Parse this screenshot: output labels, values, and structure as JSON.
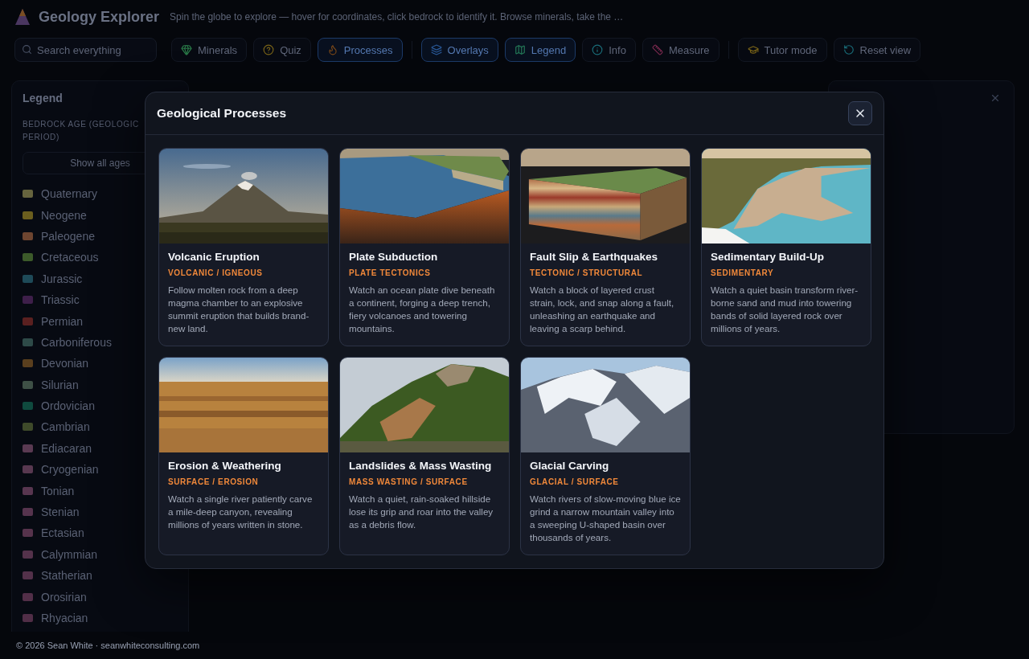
{
  "app": {
    "title": "Geology Explorer",
    "subtitle": "Spin the globe to explore — hover for coordinates, click bedrock to identify it. Browse minerals, take the …"
  },
  "toolbar": {
    "search": {
      "placeholder": "Search everything"
    },
    "groups": [
      [
        {
          "kind": "minerals",
          "label": "Minerals",
          "active": false
        },
        {
          "kind": "quiz",
          "label": "Quiz",
          "active": false
        },
        {
          "kind": "processes",
          "label": "Processes",
          "active": true
        }
      ],
      [
        {
          "kind": "overlays",
          "label": "Overlays",
          "active": true
        },
        {
          "kind": "legend",
          "label": "Legend",
          "active": true
        },
        {
          "kind": "info",
          "label": "Info",
          "active": false
        },
        {
          "kind": "measure",
          "label": "Measure",
          "active": false
        }
      ],
      [
        {
          "kind": "tutor",
          "label": "Tutor mode",
          "active": false
        },
        {
          "kind": "reset",
          "label": "Reset view",
          "active": false
        }
      ]
    ]
  },
  "legend_panel": {
    "title": "Legend",
    "subtitle": "BEDROCK AGE (GEOLOGIC PERIOD)",
    "button": "Show all ages",
    "periods": [
      {
        "name": "Quaternary",
        "color": "#66643e"
      },
      {
        "name": "Neogene",
        "color": "#6b5e1e"
      },
      {
        "name": "Paleogene",
        "color": "#6e4530"
      },
      {
        "name": "Cretaceous",
        "color": "#3c5a2a"
      },
      {
        "name": "Jurassic",
        "color": "#1e4a58"
      },
      {
        "name": "Triassic",
        "color": "#3e1f4a"
      },
      {
        "name": "Permian",
        "color": "#5a2020"
      },
      {
        "name": "Carboniferous",
        "color": "#2e4a48"
      },
      {
        "name": "Devonian",
        "color": "#5a3f1e"
      },
      {
        "name": "Silurian",
        "color": "#3e5046"
      },
      {
        "name": "Ordovician",
        "color": "#0f4a3e"
      },
      {
        "name": "Cambrian",
        "color": "#3e4a2a"
      },
      {
        "name": "Ediacaran",
        "color": "#5a3a52"
      },
      {
        "name": "Cryogenian",
        "color": "#583850"
      },
      {
        "name": "Tonian",
        "color": "#583650"
      },
      {
        "name": "Stenian",
        "color": "#56344e"
      },
      {
        "name": "Ectasian",
        "color": "#56334c"
      },
      {
        "name": "Calymmian",
        "color": "#54324b"
      },
      {
        "name": "Statherian",
        "color": "#53314a"
      },
      {
        "name": "Orosirian",
        "color": "#522f48"
      },
      {
        "name": "Rhyacian",
        "color": "#512e47"
      }
    ]
  },
  "modal": {
    "title": "Geological Processes",
    "cards": [
      {
        "kind": "volcano",
        "title": "Volcanic Eruption",
        "category": "VOLCANIC / IGNEOUS",
        "description": "Follow molten rock from a deep magma chamber to an explosive summit eruption that builds brand-new land."
      },
      {
        "kind": "subduction",
        "title": "Plate Subduction",
        "category": "PLATE TECTONICS",
        "description": "Watch an ocean plate dive beneath a continent, forging a deep trench, fiery volcanoes and towering mountains."
      },
      {
        "kind": "fault",
        "title": "Fault Slip & Earthquakes",
        "category": "TECTONIC / STRUCTURAL",
        "description": "Watch a block of layered crust strain, lock, and snap along a fault, unleashing an earthquake and leaving a scarp behind."
      },
      {
        "kind": "sediment",
        "title": "Sedimentary Build-Up",
        "category": "SEDIMENTARY",
        "description": "Watch a quiet basin transform river-borne sand and mud into towering bands of solid layered rock over millions of years."
      },
      {
        "kind": "canyon",
        "title": "Erosion & Weathering",
        "category": "SURFACE / EROSION",
        "description": "Watch a single river patiently carve a mile-deep canyon, revealing millions of years written in stone."
      },
      {
        "kind": "landslide",
        "title": "Landslides & Mass Wasting",
        "category": "MASS WASTING / SURFACE",
        "description": "Watch a quiet, rain-soaked hillside lose its grip and roar into the valley as a debris flow."
      },
      {
        "kind": "glacier",
        "title": "Glacial Carving",
        "category": "GLACIAL / SURFACE",
        "description": "Watch rivers of slow-moving blue ice grind a narrow mountain valley into a sweeping U-shaped basin over thousands of years."
      }
    ]
  },
  "footer": {
    "text": "© 2026 Sean White · seanwhiteconsulting.com"
  }
}
